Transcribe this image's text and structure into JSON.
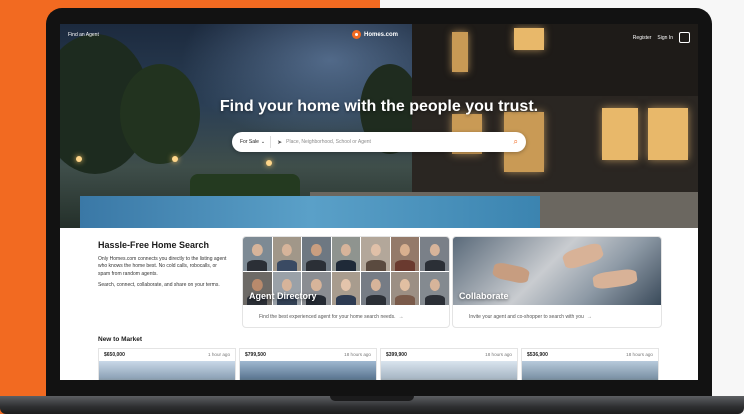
{
  "colors": {
    "brand": "#f26a21",
    "hero_title": "#ffffff",
    "card_border": "#e4e4e4"
  },
  "nav": {
    "left_link": "Find an Agent",
    "logo_text": "Homes.com",
    "logo_icon": "homes-logo-icon",
    "register": "Register",
    "sign_in": "Sign In",
    "menu_icon": "menu-icon"
  },
  "hero": {
    "title": "Find your home with the people you trust.",
    "search": {
      "type_label": "For Sale",
      "type_icon": "chevron-down-icon",
      "placeholder": "Place, Neighborhood, School or Agent",
      "nav_icon": "location-arrow-icon",
      "search_icon": "search-icon"
    }
  },
  "intro": {
    "title": "Hassle-Free Home Search",
    "paragraphs": [
      "Only Homes.com connects you directly to the listing agent who knows the home best. No cold calls, robocalls, or spam from random agents.",
      "Search, connect, collaborate, and share on your terms."
    ]
  },
  "cards": [
    {
      "label": "Agent Directory",
      "subtitle": "Find the best experienced agent for your home search needs.",
      "arrow": "→"
    },
    {
      "label": "Collaborate",
      "subtitle": "Invite your agent and co-shopper to search with you",
      "arrow": "→"
    }
  ],
  "new_to_market": {
    "title": "New to Market",
    "listings": [
      {
        "price": "$650,000",
        "time": "1 hour ago"
      },
      {
        "price": "$799,500",
        "time": "18 hours ago"
      },
      {
        "price": "$399,900",
        "time": "18 hours ago"
      },
      {
        "price": "$536,900",
        "time": "18 hours ago"
      }
    ]
  }
}
